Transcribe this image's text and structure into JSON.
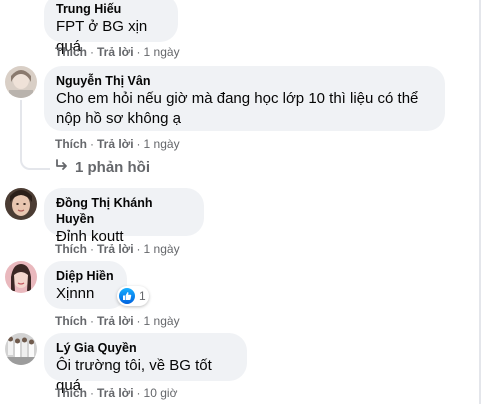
{
  "actions": {
    "like": "Thích",
    "reply": "Trả lời",
    "dot": "·"
  },
  "comments": [
    {
      "name": "Trung Hiếu",
      "text": "FPT ở BG xịn quá",
      "time": "1 ngày"
    },
    {
      "name": "Nguyễn Thị Vân",
      "text_line1": "Cho em hỏi nếu giờ mà đang học lớp 10 thì liệu có thể",
      "text_line2": "nộp hồ sơ không ạ",
      "time": "1 ngày",
      "replies_label": "1 phản hồi"
    },
    {
      "name": "Đồng Thị Khánh Huyền",
      "text": "Đỉnh koutt",
      "time": "1 ngày"
    },
    {
      "name": "Diệp Hiền",
      "text": "Xịnnn",
      "time": "1 ngày",
      "reaction_count": "1"
    },
    {
      "name": "Lý Gia Quyền",
      "text": "Ôi trường tôi, về BG tốt quá",
      "time": "10 giờ"
    }
  ],
  "colors": {
    "bubble": "#f0f2f5",
    "meta": "#65676b",
    "like": "#0062df"
  }
}
